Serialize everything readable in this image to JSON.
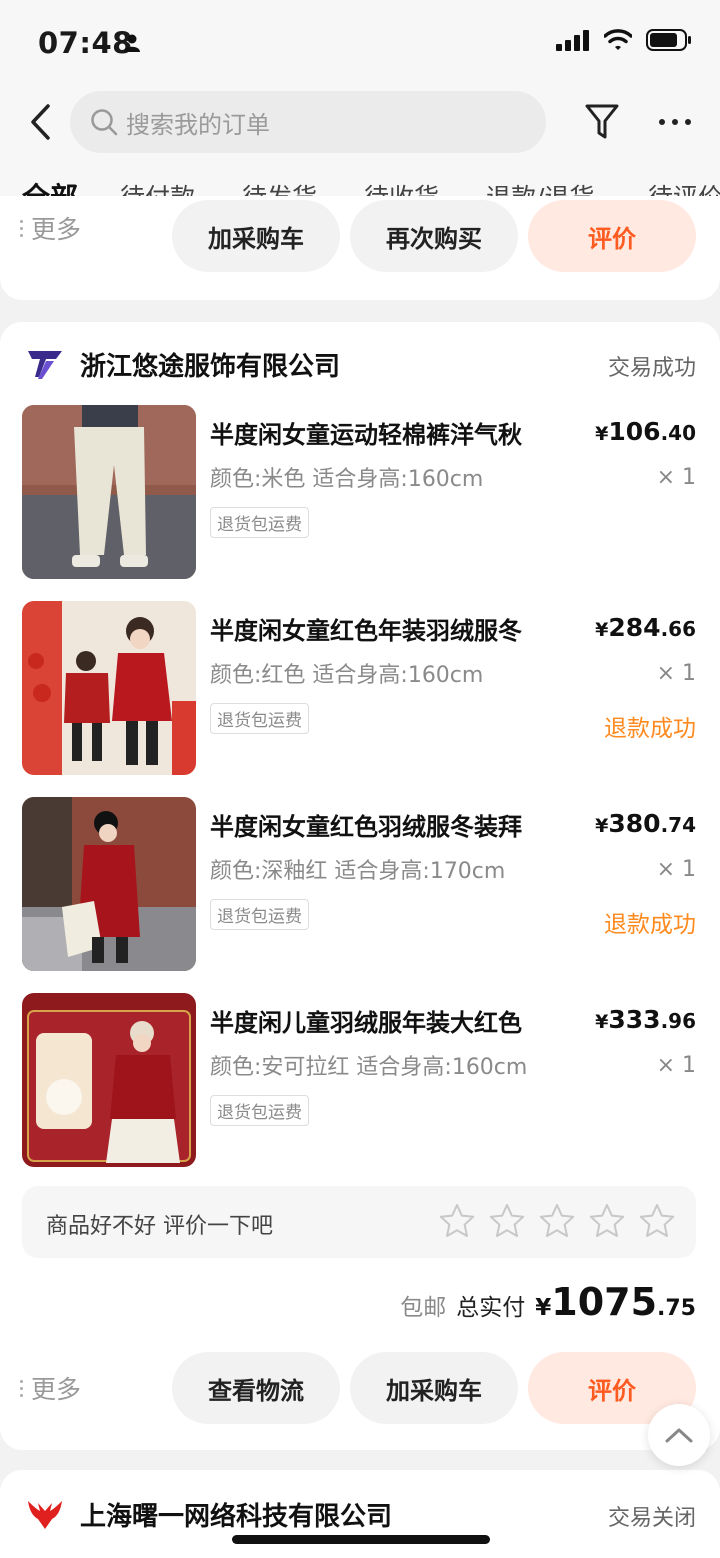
{
  "status_bar": {
    "time": "07:48"
  },
  "header": {
    "search_placeholder": "搜索我的订单",
    "tabs": [
      "全部",
      "待付款",
      "待发货",
      "待收货",
      "退款/退货",
      "待评价"
    ]
  },
  "prev_order": {
    "more_label": "更多",
    "actions": [
      "加采购车",
      "再次购买",
      "评价"
    ]
  },
  "order": {
    "shop_name": "浙江悠途服饰有限公司",
    "status": "交易成功",
    "items": [
      {
        "title": "半度闲女童运动轻棉裤洋气秋",
        "spec": "颜色:米色 适合身高:160cm",
        "badge": "退货包运费",
        "price_yen": "¥",
        "price_int": "106",
        "price_dec": ".40",
        "qty": "× 1",
        "refund": ""
      },
      {
        "title": "半度闲女童红色年装羽绒服冬",
        "spec": "颜色:红色 适合身高:160cm",
        "badge": "退货包运费",
        "price_yen": "¥",
        "price_int": "284",
        "price_dec": ".66",
        "qty": "× 1",
        "refund": "退款成功"
      },
      {
        "title": "半度闲女童红色羽绒服冬装拜",
        "spec": "颜色:深釉红 适合身高:170cm",
        "badge": "退货包运费",
        "price_yen": "¥",
        "price_int": "380",
        "price_dec": ".74",
        "qty": "× 1",
        "refund": "退款成功"
      },
      {
        "title": "半度闲儿童羽绒服年装大红色",
        "spec": "颜色:安可拉红 适合身高:160cm",
        "badge": "退货包运费",
        "price_yen": "¥",
        "price_int": "333",
        "price_dec": ".96",
        "qty": "× 1",
        "refund": ""
      }
    ],
    "rate_prompt": "商品好不好 评价一下吧",
    "rating_stars": 0,
    "free_shipping": "包邮",
    "paid_label": "总实付",
    "total_yen": "¥",
    "total_int": "1075",
    "total_dec": ".75",
    "more_label": "更多",
    "actions": [
      "查看物流",
      "加采购车",
      "评价"
    ]
  },
  "next_order": {
    "shop_name": "上海曙一网络科技有限公司",
    "status": "交易关闭"
  },
  "colors": {
    "accent": "#ff5a1f",
    "refund": "#ff8a1f",
    "accent_bg": "#ffe9e0"
  }
}
